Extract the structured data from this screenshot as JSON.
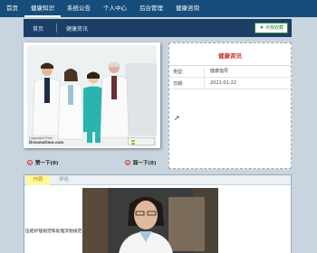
{
  "nav": {
    "items": [
      "首页",
      "健康知识",
      "系统公告",
      "个人中心",
      "后台管理",
      "健康咨询"
    ],
    "active_index": 1
  },
  "breadcrumb": {
    "home": "首页",
    "current": "健康资讯",
    "favorite_label": "点我收藏"
  },
  "photo": {
    "caption_line1": "Copyright Free",
    "caption_line2": "Dreamstime.com"
  },
  "votes": {
    "up_label": "赞一下(0)",
    "down_label": "踩一下(0)"
  },
  "info": {
    "title": "健康资讯",
    "rows": [
      {
        "label": "类型:",
        "value": "健康指导"
      },
      {
        "label": "日期:",
        "value": "2021-01-22"
      }
    ]
  },
  "tabs": {
    "active": "内容",
    "other": "评论"
  },
  "content": {
    "text": "压疮护理规范和处理流程规范"
  },
  "colors": {
    "nav_bg": "#164d7a",
    "crumb_bg": "#1c3f68",
    "accent_red": "#c0392b",
    "accent_green": "#2e8b3e"
  }
}
